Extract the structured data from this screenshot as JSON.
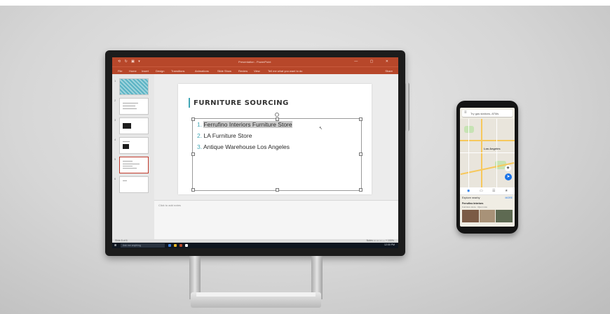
{
  "powerpoint": {
    "window_title": "Presentation - PowerPoint",
    "quick_access": "⟲ ↻ ▣ ▾",
    "window_controls": "— ▢ ✕",
    "ribbon_tabs": [
      "File",
      "Home",
      "Insert",
      "Design",
      "Transitions",
      "Animations",
      "Slide Show",
      "Review",
      "View",
      "Tell me what you want to do"
    ],
    "ribbon_right": "Share",
    "thumb_numbers": [
      "1",
      "2",
      "3",
      "4",
      "5",
      "6"
    ],
    "slide": {
      "title": "FURNITURE SOURCING",
      "items": [
        {
          "num": "1.",
          "text": "Ferrufino Interiors Furniture Store",
          "selected": true
        },
        {
          "num": "2.",
          "text": "LA Furniture Store",
          "selected": false
        },
        {
          "num": "3.",
          "text": "Antique Warehouse Los Angeles",
          "selected": false
        }
      ]
    },
    "notes_placeholder": "Click to add notes",
    "status_left": "Slide 5 of 6",
    "status_right": "Notes  ▭  ▭  ▭  —  +  100%"
  },
  "taskbar": {
    "start": "⊞",
    "search_placeholder": "Ask me anything",
    "clock": "12:00 PM"
  },
  "phone": {
    "search_text": "Try gas stations, ATMs",
    "map_label": "Los Angeles",
    "tabs": [
      "◉",
      "▭",
      "☰",
      "★"
    ],
    "section_title": "Explore nearby",
    "section_more": "MORE",
    "card_title": "Ferrufino Interiors",
    "card_sub": "Furniture store · Open now"
  },
  "colors": {
    "ppt_accent": "#b7472a",
    "slide_accent": "#41a6b5",
    "maps_blue": "#1a73e8"
  }
}
